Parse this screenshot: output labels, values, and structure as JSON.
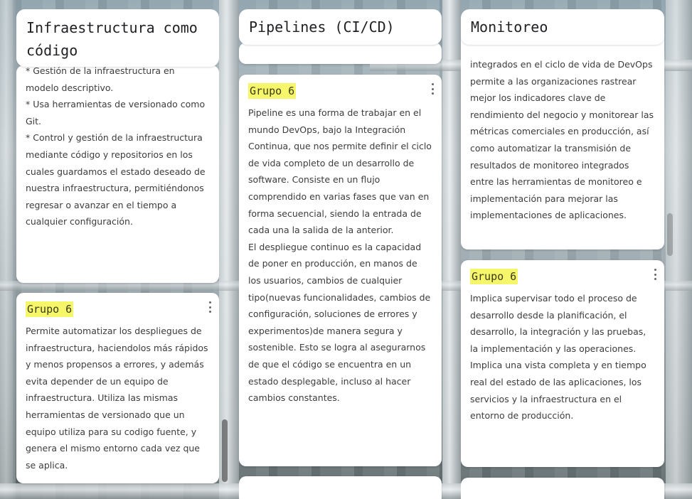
{
  "columns": [
    {
      "title": "Infraestructura como código",
      "cards": [
        {
          "author": "",
          "body": "* Gestión de la infraestructura en modelo descriptivo.\n* Usa herramientas de versionado como Git.\n* Control y gestión de la infraestructura mediante código y repositorios en los cuales guardamos el estado deseado de nuestra infraestructura, permitiéndonos regresar o avanzar en el tiempo a cualquier configuración."
        },
        {
          "author": "Grupo 6",
          "body": "Permite automatizar los despliegues de infraestructura, haciendolos más rápidos y menos propensos a errores, y además evita depender de un equipo de infraestructura. Utiliza las mismas herramientas de versionado que un equipo utiliza para su codigo fuente, y genera el mismo entorno cada vez que se aplica."
        }
      ]
    },
    {
      "title": "Pipelines (CI/CD)",
      "cards": [
        {
          "author": "Grupo 6",
          "body": "Pipeline es una forma de trabajar en el mundo DevOps, bajo la Integración Continua, que nos permite definir el ciclo de vida completo de un desarrollo de software. Consiste en un flujo comprendido en varias fases que van en forma secuencial, siendo la entrada de cada una la salida de la anterior.\nEl despliegue continuo es la capacidad de poner en producción, en manos de los usuarios, cambios de cualquier tipo(nuevas funcionalidades, cambios de configuración, soluciones de errores y experimentos)de manera segura y sostenible. Esto se logra al asegurarnos de que el código se encuentra en un estado desplegable, incluso al hacer cambios constantes."
        }
      ]
    },
    {
      "title": "Monitoreo",
      "cards": [
        {
          "author": "",
          "body": "integrados en el ciclo de vida de DevOps permite a las organizaciones rastrear mejor los indicadores clave de rendimiento del negocio y monitorear las métricas comerciales en producción, así como automatizar la transmisión de resultados de monitoreo integrados entre las herramientas de monitoreo e implementación para mejorar las implementaciones de aplicaciones."
        },
        {
          "author": "Grupo 6",
          "body": "Implica supervisar todo el proceso de desarrollo desde la planificación, el desarrollo, la integración y las pruebas, la implementación y las operaciones. Implica una vista completa y en tiempo real del estado de las aplicaciones, los servicios y la infraestructura en el entorno de producción."
        }
      ]
    }
  ],
  "icons": {
    "card_menu": "more-vert-icon"
  }
}
